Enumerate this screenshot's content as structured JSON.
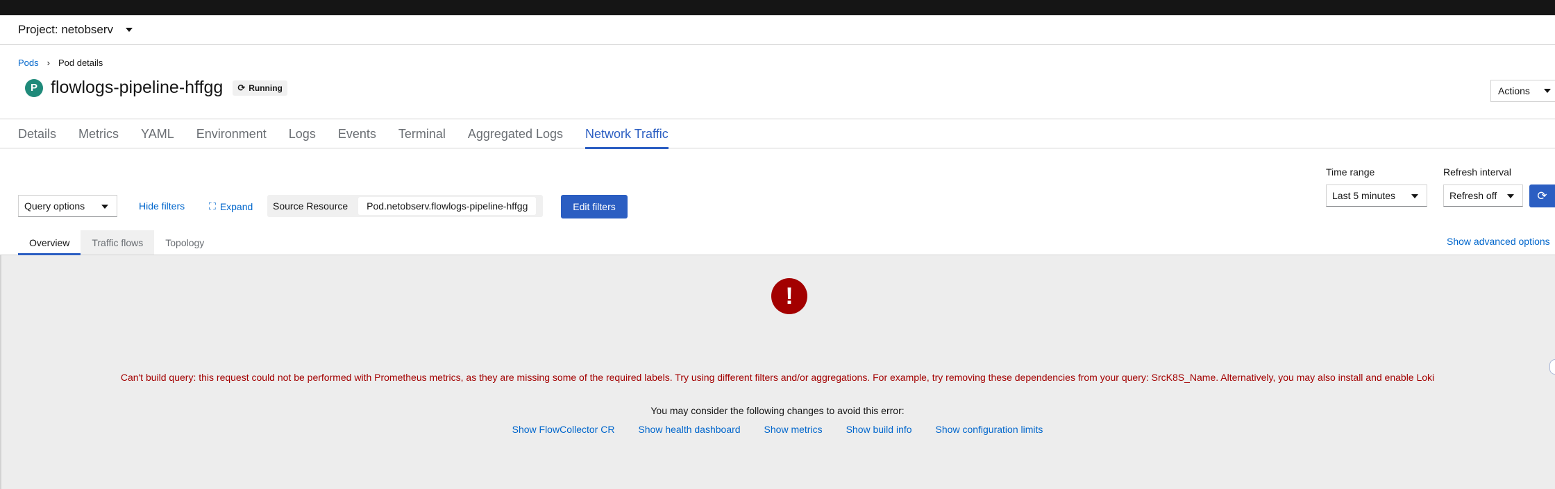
{
  "header": {
    "project_label": "Project: netobserv"
  },
  "breadcrumb": {
    "parent": "Pods",
    "current": "Pod details"
  },
  "resource": {
    "badge": "P",
    "name": "flowlogs-pipeline-hffgg",
    "status": "Running"
  },
  "actions_label": "Actions",
  "tabs": [
    "Details",
    "Metrics",
    "YAML",
    "Environment",
    "Logs",
    "Events",
    "Terminal",
    "Aggregated Logs",
    "Network Traffic"
  ],
  "active_tab": "Network Traffic",
  "toolbar": {
    "query_options": "Query options",
    "hide_filters": "Hide filters",
    "expand": "Expand",
    "filter_label": "Source Resource",
    "filter_value": "Pod.netobserv.flowlogs-pipeline-hffgg",
    "edit_filters": "Edit filters",
    "time_range_label": "Time range",
    "time_range_value": "Last 5 minutes",
    "refresh_label": "Refresh interval",
    "refresh_value": "Refresh off"
  },
  "sub_tabs": [
    "Overview",
    "Traffic flows",
    "Topology"
  ],
  "active_sub_tab": "Overview",
  "advanced_link": "Show advanced options",
  "error": {
    "message": "Can't build query: this request could not be performed with Prometheus metrics, as they are missing some of the required labels. Try using different filters and/or aggregations. For example, try removing these dependencies from your query: SrcK8S_Name. Alternatively, you may also install and enable Loki",
    "hint": "You may consider the following changes to avoid this error:",
    "links": [
      "Show FlowCollector CR",
      "Show health dashboard",
      "Show metrics",
      "Show build info",
      "Show configuration limits"
    ]
  },
  "colors": {
    "accent": "#2b5ec2",
    "link": "#0066cc",
    "danger": "#a30000",
    "badge": "#1f8a7a"
  }
}
